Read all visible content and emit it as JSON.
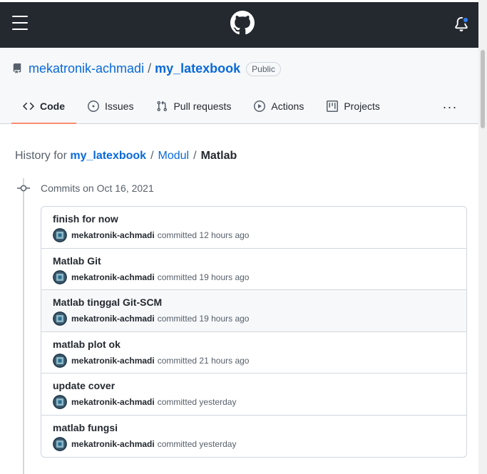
{
  "header": {
    "menu_icon": "hamburger-icon",
    "logo_icon": "github-mark-icon",
    "notification_icon": "bell-icon",
    "notification_dot_color": "#2f81f7"
  },
  "repo": {
    "owner": "mekatronik-achmadi",
    "separator": "/",
    "name": "my_latexbook",
    "visibility": "Public"
  },
  "tabs": [
    {
      "label": "Code",
      "icon": "code-icon"
    },
    {
      "label": "Issues",
      "icon": "issue-opened-icon"
    },
    {
      "label": "Pull requests",
      "icon": "git-pull-request-icon"
    },
    {
      "label": "Actions",
      "icon": "play-icon"
    },
    {
      "label": "Projects",
      "icon": "table-icon"
    }
  ],
  "tabs_more": "···",
  "breadcrumb": {
    "prefix": "History for",
    "repo": "my_latexbook",
    "sep": "/",
    "folder": "Modul",
    "current": "Matlab"
  },
  "commits_group": {
    "title": "Commits on Oct 16, 2021"
  },
  "commits": [
    {
      "message": "finish for now",
      "author": "mekatronik-achmadi",
      "action": "committed",
      "time": "12 hours ago"
    },
    {
      "message": "Matlab Git",
      "author": "mekatronik-achmadi",
      "action": "committed",
      "time": "19 hours ago"
    },
    {
      "message": "Matlab tinggal Git-SCM",
      "author": "mekatronik-achmadi",
      "action": "committed",
      "time": "19 hours ago"
    },
    {
      "message": "matlab plot ok",
      "author": "mekatronik-achmadi",
      "action": "committed",
      "time": "21 hours ago"
    },
    {
      "message": "update cover",
      "author": "mekatronik-achmadi",
      "action": "committed",
      "time": "yesterday"
    },
    {
      "message": "matlab fungsi",
      "author": "mekatronik-achmadi",
      "action": "committed",
      "time": "yesterday"
    }
  ],
  "colors": {
    "header_bg": "#24292f",
    "link": "#0969da",
    "active_tab_underline": "#fd8c73"
  }
}
